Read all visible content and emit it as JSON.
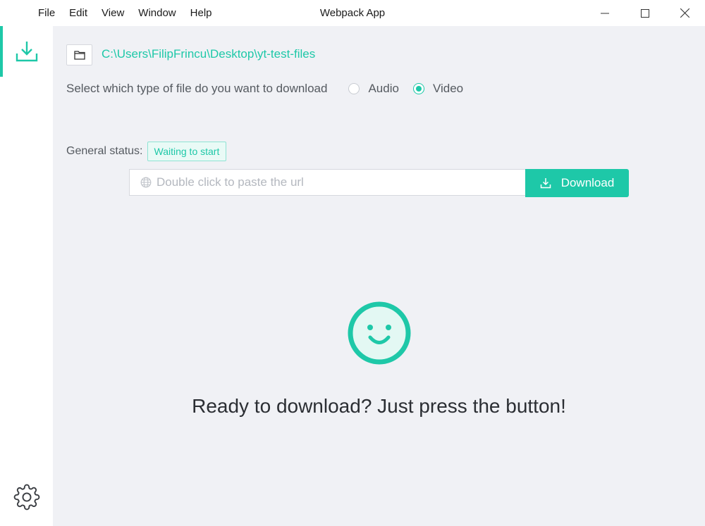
{
  "window": {
    "title": "Webpack App",
    "menu": [
      "File",
      "Edit",
      "View",
      "Window",
      "Help"
    ]
  },
  "sidebar": {
    "items": [
      {
        "icon": "download-icon",
        "active": true
      },
      {
        "icon": "gear-icon",
        "active": false
      }
    ]
  },
  "main": {
    "folder_path": "C:\\Users\\FilipFrincu\\Desktop\\yt-test-files",
    "type_prompt": "Select which type of file do you want to download",
    "type_options": [
      {
        "label": "Audio",
        "checked": false
      },
      {
        "label": "Video",
        "checked": true
      }
    ],
    "status_label": "General status:",
    "status_value": "Waiting to start",
    "url_placeholder": "Double click to paste the url",
    "url_value": "",
    "download_label": "Download",
    "ready_message": "Ready to download? Just press the button!"
  },
  "colors": {
    "accent": "#1ec8a8",
    "background": "#f0f1f5",
    "sidebar": "#ffffff"
  }
}
